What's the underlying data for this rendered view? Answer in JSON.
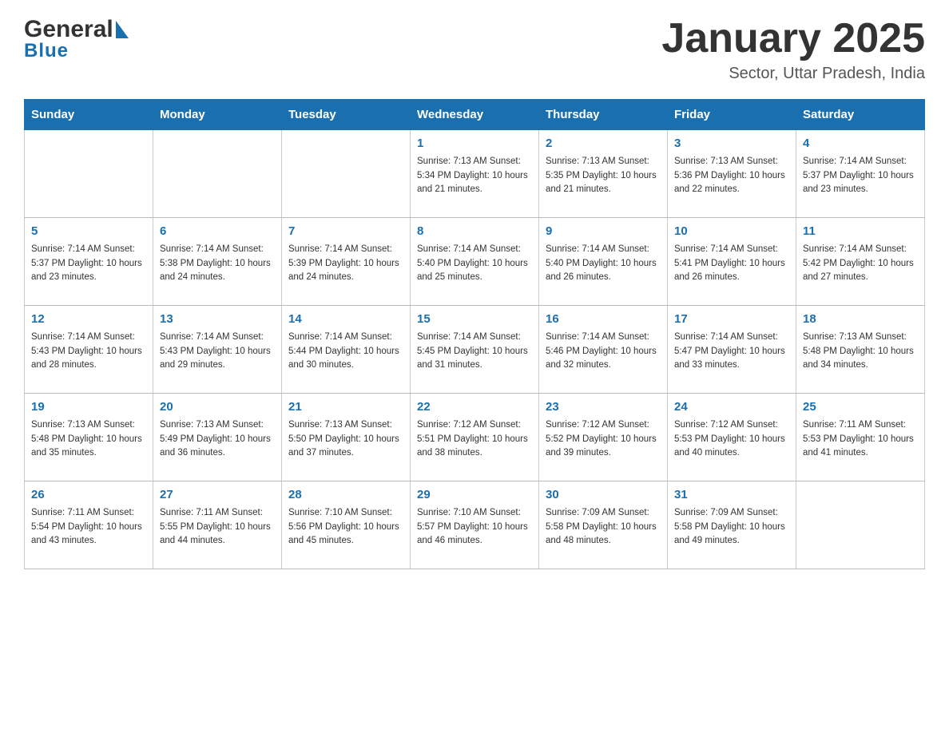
{
  "header": {
    "logo_general": "General",
    "logo_blue": "Blue",
    "month_title": "January 2025",
    "location": "Sector, Uttar Pradesh, India"
  },
  "days_header": [
    "Sunday",
    "Monday",
    "Tuesday",
    "Wednesday",
    "Thursday",
    "Friday",
    "Saturday"
  ],
  "weeks": [
    [
      {
        "day": "",
        "info": ""
      },
      {
        "day": "",
        "info": ""
      },
      {
        "day": "",
        "info": ""
      },
      {
        "day": "1",
        "info": "Sunrise: 7:13 AM\nSunset: 5:34 PM\nDaylight: 10 hours\nand 21 minutes."
      },
      {
        "day": "2",
        "info": "Sunrise: 7:13 AM\nSunset: 5:35 PM\nDaylight: 10 hours\nand 21 minutes."
      },
      {
        "day": "3",
        "info": "Sunrise: 7:13 AM\nSunset: 5:36 PM\nDaylight: 10 hours\nand 22 minutes."
      },
      {
        "day": "4",
        "info": "Sunrise: 7:14 AM\nSunset: 5:37 PM\nDaylight: 10 hours\nand 23 minutes."
      }
    ],
    [
      {
        "day": "5",
        "info": "Sunrise: 7:14 AM\nSunset: 5:37 PM\nDaylight: 10 hours\nand 23 minutes."
      },
      {
        "day": "6",
        "info": "Sunrise: 7:14 AM\nSunset: 5:38 PM\nDaylight: 10 hours\nand 24 minutes."
      },
      {
        "day": "7",
        "info": "Sunrise: 7:14 AM\nSunset: 5:39 PM\nDaylight: 10 hours\nand 24 minutes."
      },
      {
        "day": "8",
        "info": "Sunrise: 7:14 AM\nSunset: 5:40 PM\nDaylight: 10 hours\nand 25 minutes."
      },
      {
        "day": "9",
        "info": "Sunrise: 7:14 AM\nSunset: 5:40 PM\nDaylight: 10 hours\nand 26 minutes."
      },
      {
        "day": "10",
        "info": "Sunrise: 7:14 AM\nSunset: 5:41 PM\nDaylight: 10 hours\nand 26 minutes."
      },
      {
        "day": "11",
        "info": "Sunrise: 7:14 AM\nSunset: 5:42 PM\nDaylight: 10 hours\nand 27 minutes."
      }
    ],
    [
      {
        "day": "12",
        "info": "Sunrise: 7:14 AM\nSunset: 5:43 PM\nDaylight: 10 hours\nand 28 minutes."
      },
      {
        "day": "13",
        "info": "Sunrise: 7:14 AM\nSunset: 5:43 PM\nDaylight: 10 hours\nand 29 minutes."
      },
      {
        "day": "14",
        "info": "Sunrise: 7:14 AM\nSunset: 5:44 PM\nDaylight: 10 hours\nand 30 minutes."
      },
      {
        "day": "15",
        "info": "Sunrise: 7:14 AM\nSunset: 5:45 PM\nDaylight: 10 hours\nand 31 minutes."
      },
      {
        "day": "16",
        "info": "Sunrise: 7:14 AM\nSunset: 5:46 PM\nDaylight: 10 hours\nand 32 minutes."
      },
      {
        "day": "17",
        "info": "Sunrise: 7:14 AM\nSunset: 5:47 PM\nDaylight: 10 hours\nand 33 minutes."
      },
      {
        "day": "18",
        "info": "Sunrise: 7:13 AM\nSunset: 5:48 PM\nDaylight: 10 hours\nand 34 minutes."
      }
    ],
    [
      {
        "day": "19",
        "info": "Sunrise: 7:13 AM\nSunset: 5:48 PM\nDaylight: 10 hours\nand 35 minutes."
      },
      {
        "day": "20",
        "info": "Sunrise: 7:13 AM\nSunset: 5:49 PM\nDaylight: 10 hours\nand 36 minutes."
      },
      {
        "day": "21",
        "info": "Sunrise: 7:13 AM\nSunset: 5:50 PM\nDaylight: 10 hours\nand 37 minutes."
      },
      {
        "day": "22",
        "info": "Sunrise: 7:12 AM\nSunset: 5:51 PM\nDaylight: 10 hours\nand 38 minutes."
      },
      {
        "day": "23",
        "info": "Sunrise: 7:12 AM\nSunset: 5:52 PM\nDaylight: 10 hours\nand 39 minutes."
      },
      {
        "day": "24",
        "info": "Sunrise: 7:12 AM\nSunset: 5:53 PM\nDaylight: 10 hours\nand 40 minutes."
      },
      {
        "day": "25",
        "info": "Sunrise: 7:11 AM\nSunset: 5:53 PM\nDaylight: 10 hours\nand 41 minutes."
      }
    ],
    [
      {
        "day": "26",
        "info": "Sunrise: 7:11 AM\nSunset: 5:54 PM\nDaylight: 10 hours\nand 43 minutes."
      },
      {
        "day": "27",
        "info": "Sunrise: 7:11 AM\nSunset: 5:55 PM\nDaylight: 10 hours\nand 44 minutes."
      },
      {
        "day": "28",
        "info": "Sunrise: 7:10 AM\nSunset: 5:56 PM\nDaylight: 10 hours\nand 45 minutes."
      },
      {
        "day": "29",
        "info": "Sunrise: 7:10 AM\nSunset: 5:57 PM\nDaylight: 10 hours\nand 46 minutes."
      },
      {
        "day": "30",
        "info": "Sunrise: 7:09 AM\nSunset: 5:58 PM\nDaylight: 10 hours\nand 48 minutes."
      },
      {
        "day": "31",
        "info": "Sunrise: 7:09 AM\nSunset: 5:58 PM\nDaylight: 10 hours\nand 49 minutes."
      },
      {
        "day": "",
        "info": ""
      }
    ]
  ]
}
